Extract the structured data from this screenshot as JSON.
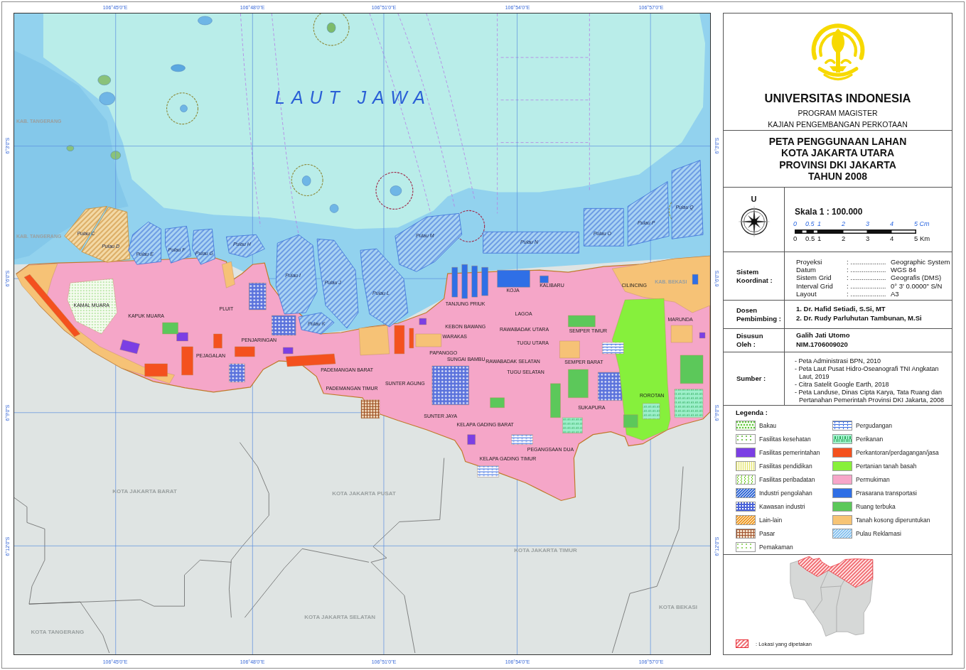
{
  "map": {
    "top_ticks": [
      "106°45'0\"E",
      "106°48'0\"E",
      "106°51'0\"E",
      "106°54'0\"E",
      "106°57'0\"E"
    ],
    "bottom_ticks": [
      "106°45'0\"E",
      "106°48'0\"E",
      "106°51'0\"E",
      "106°54'0\"E",
      "106°57'0\"E"
    ],
    "left_ticks": [
      "6°3'0\"S",
      "6°6'0\"S",
      "6°9'0\"S",
      "6°12'0\"S"
    ],
    "right_ticks": [
      "6°3'0\"S",
      "6°6'0\"S",
      "6°9'0\"S",
      "6°12'0\"S"
    ],
    "sea_label": "LAUT JAWA",
    "islands": [
      {
        "label": "Pulau C",
        "kind": "mixed"
      },
      {
        "label": "Pulau D",
        "kind": "mixed"
      },
      {
        "label": "Pulau E",
        "kind": "reclaimed"
      },
      {
        "label": "Pulau F",
        "kind": "reclaimed"
      },
      {
        "label": "Pulau G",
        "kind": "reclaimed"
      },
      {
        "label": "Pulau H",
        "kind": "reclaimed"
      },
      {
        "label": "Pulau I",
        "kind": "reclaimed"
      },
      {
        "label": "Pulau J",
        "kind": "reclaimed"
      },
      {
        "label": "Pulau K",
        "kind": "reclaimed"
      },
      {
        "label": "Pulau L",
        "kind": "reclaimed"
      },
      {
        "label": "Pulau M",
        "kind": "reclaimed"
      },
      {
        "label": "Pulau N",
        "kind": "reclaimed"
      },
      {
        "label": "Pulau O",
        "kind": "reclaimed"
      },
      {
        "label": "Pulau P",
        "kind": "reclaimed"
      },
      {
        "label": "Pulau Q",
        "kind": "reclaimed"
      }
    ],
    "districts": [
      "KAMAL MUARA",
      "KAPUK MUARA",
      "PLUIT",
      "PENJARINGAN",
      "PEJAGALAN",
      "PADEMANGAN BARAT",
      "PADEMANGAN TIMUR",
      "TANJUNG PRIUK",
      "KOJA",
      "KALIBARU",
      "CILINCING",
      "MARUNDA",
      "LAGOA",
      "KEBON BAWANG",
      "RAWABADAK UTARA",
      "WARAKAS",
      "TUGU UTARA",
      "SEMPER TIMUR",
      "PAPANGGO",
      "SUNGAI BAMBU",
      "RAWABADAK SELATAN",
      "SEMPER BARAT",
      "TUGU SELATAN",
      "SUNTER AGUNG",
      "ROROTAN",
      "SUKAPURA",
      "SUNTER JAYA",
      "KELAPA GADING BARAT",
      "PEGANGSAAN DUA",
      "KELAPA GADING TIMUR"
    ],
    "regions": [
      "KAB. TANGERANG",
      "KAB. TANGERANG",
      "KAB. BEKASI",
      "KOTA JAKARTA BARAT",
      "KOTA JAKARTA PUSAT",
      "KOTA JAKARTA TIMUR",
      "KOTA JAKARTA SELATAN",
      "KOTA TANGERANG",
      "KOTA BEKASI"
    ]
  },
  "header": {
    "university": "UNIVERSITAS INDONESIA",
    "program": "PROGRAM MAGISTER",
    "department": "KAJIAN PENGEMBANGAN PERKOTAAN"
  },
  "title_lines": [
    "PETA PENGGUNAAN LAHAN",
    "KOTA JAKARTA UTARA",
    "PROVINSI DKI JAKARTA",
    "TAHUN 2008"
  ],
  "orientation": {
    "north_label": "U"
  },
  "scale": {
    "title": "Skala 1 : 100.000",
    "cm_labels": [
      "0",
      "0.5",
      "1",
      "2",
      "3",
      "4",
      "5 Cm"
    ],
    "km_labels": [
      "0",
      "0.5",
      "1",
      "2",
      "3",
      "4",
      "5 Km"
    ]
  },
  "info": [
    {
      "kind": "table",
      "label": [
        "Sistem",
        "Koordinat :"
      ],
      "rows": [
        {
          "name": "Proyeksi",
          "leader": ": ...................",
          "value": "Geographic System"
        },
        {
          "name": "Datum",
          "leader": ": ...................",
          "value": "WGS 84"
        },
        {
          "name": "Sistem Grid",
          "leader": ": ...................",
          "value": "Geografis (DMS)"
        },
        {
          "name": "Interval Grid",
          "leader": ": ...................",
          "value": "0° 3' 0.0000\" S/N"
        },
        {
          "name": "Layout",
          "leader": ": ...................",
          "value": "A3"
        }
      ]
    },
    {
      "kind": "names",
      "label": [
        "Dosen",
        "Pembimbing :"
      ],
      "lines": [
        "1. Dr. Hafid Setiadi, S.Si, MT",
        "2. Dr. Rudy Parluhutan Tambunan, M.Si"
      ]
    },
    {
      "kind": "names",
      "label": [
        "Disusun",
        "Oleh :"
      ],
      "lines": [
        "Galih Jati Utomo",
        "NIM.1706009020"
      ]
    },
    {
      "kind": "list",
      "label": [
        "Sumber :"
      ],
      "lines": [
        "- Peta Administrasi BPN, 2010",
        "- Peta Laut Pusat Hidro-Oseanografi TNI Angkatan Laut, 2019",
        "- Citra Satelit Google Earth, 2018",
        "- Peta Landuse, Dinas Cipta Karya, Tata Ruang dan Pertanahan Pemerintah Provinsi DKI Jakarta, 2008"
      ]
    }
  ],
  "legend": {
    "title": "Legenda :",
    "left": [
      {
        "label": "Bakau",
        "kind": "dots",
        "color": "#5cc83a"
      },
      {
        "label": "Fasilitas kesehatan",
        "kind": "specks",
        "color": "#7cc85a"
      },
      {
        "label": "Fasilitas pemerintahan",
        "kind": "solid",
        "color": "#7b3fe4"
      },
      {
        "label": "Fasilitas pendidikan",
        "kind": "vlines",
        "color": "#e3e36a"
      },
      {
        "label": "Fasilitas peribadatan",
        "kind": "waves",
        "color": "#6cc820"
      },
      {
        "label": "Industri pengolahan",
        "kind": "hatch",
        "color": "#3b6fd8"
      },
      {
        "label": "Kawasan industri",
        "kind": "blocks",
        "color": "#4a62d8"
      },
      {
        "label": "Lain-lain",
        "kind": "hatch",
        "color": "#f0a030"
      },
      {
        "label": "Pasar",
        "kind": "grid",
        "color": "#a0522d"
      },
      {
        "label": "Pemakaman",
        "kind": "specks",
        "color": "#9ad66e"
      }
    ],
    "right": [
      {
        "label": "Pergudangan",
        "kind": "bricks",
        "color": "#3d6fe0"
      },
      {
        "label": "Perikanan",
        "kind": "symbols",
        "color": "#2fae5f"
      },
      {
        "label": "Perkantoran/perdagangan/jasa",
        "kind": "solid",
        "color": "#f4511e"
      },
      {
        "label": "Pertanian tanah basah",
        "kind": "solid",
        "color": "#88f03a"
      },
      {
        "label": "Permukiman",
        "kind": "solid",
        "color": "#f7a6c9"
      },
      {
        "label": "Prasarana transportasi",
        "kind": "solid",
        "color": "#2f6fe6"
      },
      {
        "label": "Ruang terbuka",
        "kind": "solid",
        "color": "#5cc85a"
      },
      {
        "label": "Tanah kosong diperuntukan",
        "kind": "solid",
        "color": "#f7c475"
      },
      {
        "label": "Pulau Reklamasi",
        "kind": "hatch",
        "color": "#8fc6f0"
      }
    ]
  },
  "locator": {
    "caption": ": Lokasi yang dipetakan"
  }
}
